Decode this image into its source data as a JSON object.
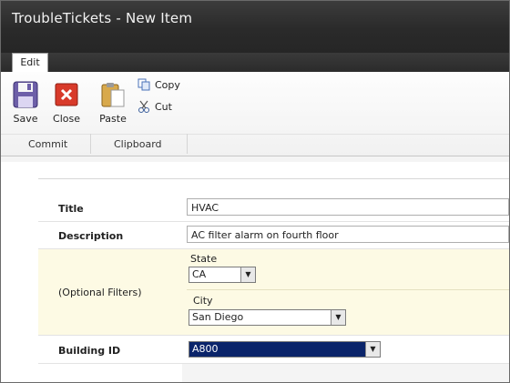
{
  "window": {
    "title": "TroubleTickets - New Item"
  },
  "ribbon": {
    "tab": "Edit",
    "save_label": "Save",
    "close_label": "Close",
    "paste_label": "Paste",
    "copy_label": "Copy",
    "cut_label": "Cut",
    "group_commit": "Commit",
    "group_clipboard": "Clipboard"
  },
  "form": {
    "title_label": "Title",
    "title_value": "HVAC",
    "description_label": "Description",
    "description_value": "AC filter alarm on fourth floor",
    "filters_label": "(Optional Filters)",
    "state_label": "State",
    "state_value": "CA",
    "city_label": "City",
    "city_value": "San Diego",
    "building_label": "Building ID",
    "building_value": "A800"
  },
  "colors": {
    "filter_background": "#fdfae4",
    "selected_dropdown": "#0a246a"
  }
}
